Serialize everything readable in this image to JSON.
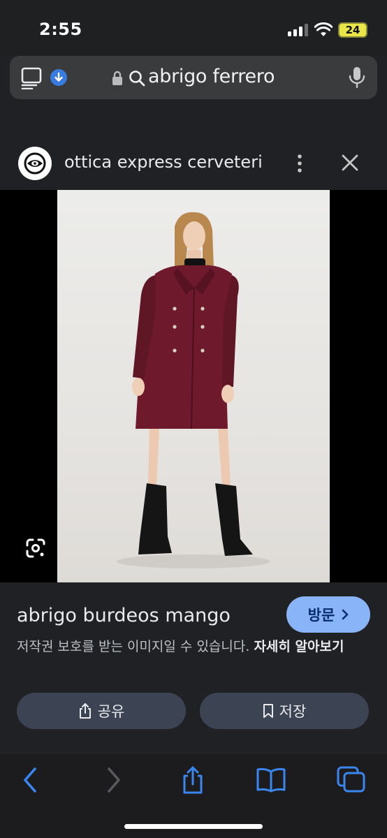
{
  "status_bar": {
    "time": "2:55",
    "battery": "24"
  },
  "browser": {
    "search_text": "abrigo ferrero"
  },
  "panel": {
    "site_name": "ottica express cerveteri"
  },
  "result": {
    "title": "abrigo burdeos mango",
    "visit_label": "방문",
    "copyright_text": "저작권 보호를 받는 이미지일 수 있습니다.",
    "learn_more": "자세히 알아보기",
    "share_label": "공유",
    "save_label": "저장"
  },
  "colors": {
    "accent": "#8ab4f8",
    "toolbar_icon": "#3a86f0",
    "coat": "#6e1a2c"
  },
  "icons": [
    "tabs-icon",
    "download-icon",
    "lock-icon",
    "search-icon",
    "mic-icon",
    "more-vert-icon",
    "close-icon",
    "google-lens-icon",
    "share-icon",
    "bookmark-icon",
    "back-icon",
    "forward-icon",
    "safari-share-icon",
    "bookmarks-book-icon",
    "tabs-overview-icon"
  ]
}
